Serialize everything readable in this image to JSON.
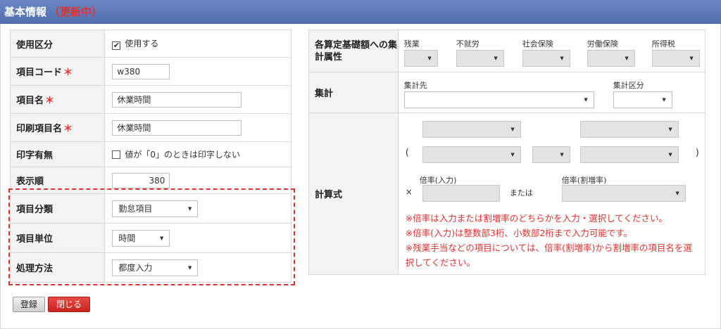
{
  "header": {
    "title": "基本情報",
    "status": "（更新中）"
  },
  "left": {
    "usage": {
      "label": "使用区分",
      "checkbox_label": "使用する",
      "checked": true
    },
    "code": {
      "label": "項目コード",
      "required": "＊",
      "value": "w380"
    },
    "name": {
      "label": "項目名",
      "required": "＊",
      "value": "休業時間"
    },
    "print_name": {
      "label": "印刷項目名",
      "required": "＊",
      "value": "休業時間"
    },
    "print_flag": {
      "label": "印字有無",
      "checkbox_label": "値が「0」のときは印字しない",
      "checked": false
    },
    "order": {
      "label": "表示順",
      "value": "380"
    },
    "category": {
      "label": "項目分類",
      "value": "勤怠項目"
    },
    "unit": {
      "label": "項目単位",
      "value": "時間"
    },
    "method": {
      "label": "処理方法",
      "value": "都度入力"
    }
  },
  "right": {
    "attr": {
      "label": "各算定基礎額への集計属性",
      "cols": [
        "残業",
        "不就労",
        "社会保険",
        "労働保険",
        "所得税"
      ]
    },
    "agg": {
      "label": "集計",
      "dest_label": "集計先",
      "div_label": "集計区分"
    },
    "formula": {
      "label": "計算式",
      "open_paren": "(",
      "close_paren": ")",
      "times": "×",
      "rate_input_label": "倍率(入力)",
      "or": "または",
      "rate_add_label": "倍率(割増率)",
      "notes": [
        "※倍率は入力または割増率のどちらかを入力・選択してください。",
        "※倍率(入力)は整数部3桁、小数部2桁まで入力可能です。",
        "※残業手当などの項目については、倍率(割増率)から割増率の項目名を選",
        "択してください。"
      ]
    }
  },
  "buttons": {
    "register": "登録",
    "close": "閉じる"
  },
  "colors": {
    "header": "#5573b6",
    "accent_red": "#e0322d"
  }
}
